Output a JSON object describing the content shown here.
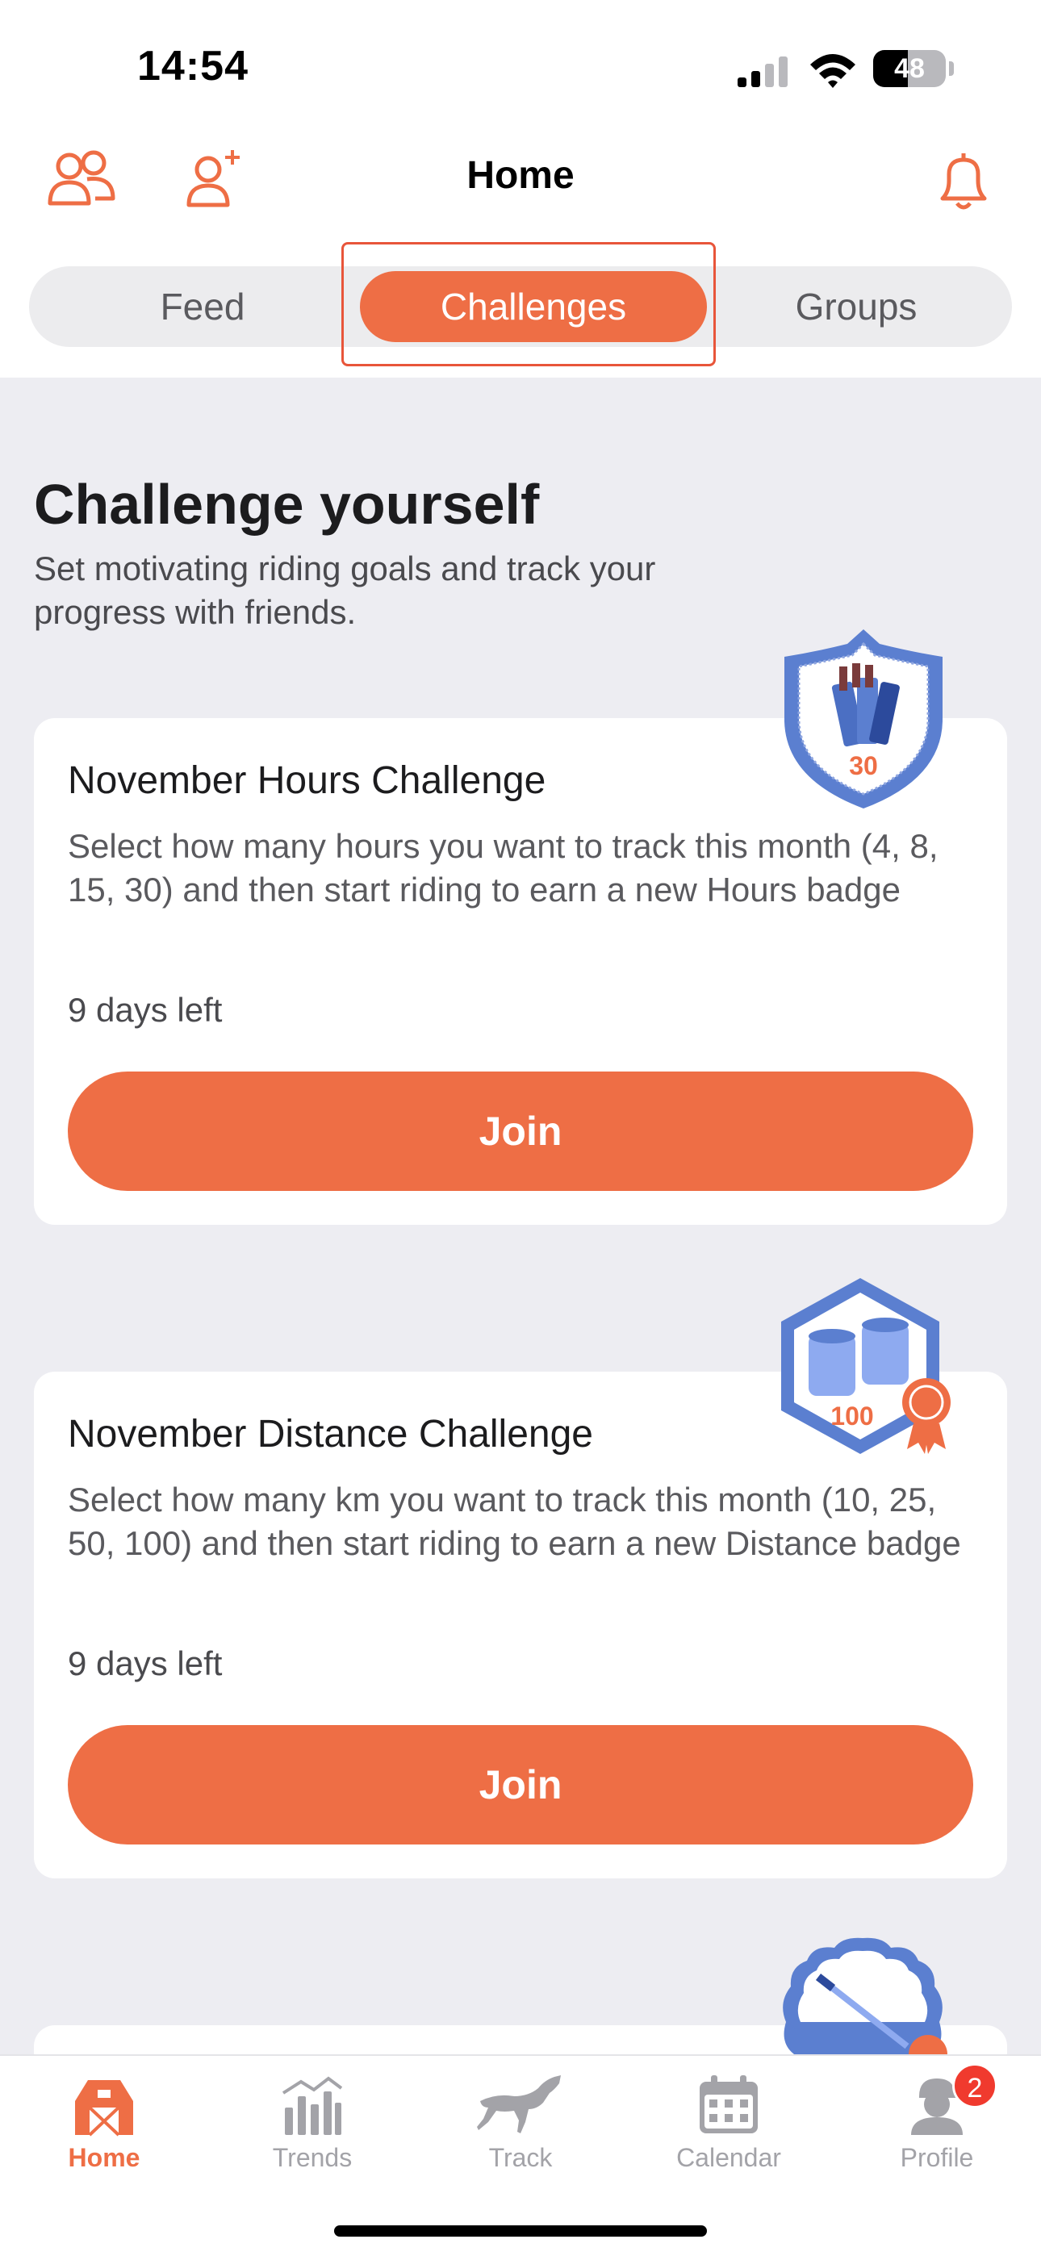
{
  "status": {
    "time": "14:54",
    "battery": "48",
    "battery_level": 0.48
  },
  "header": {
    "title": "Home"
  },
  "segments": {
    "feed": "Feed",
    "challenges": "Challenges",
    "groups": "Groups",
    "selected": "Challenges"
  },
  "intro": {
    "title": "Challenge yourself",
    "subtitle": "Set motivating riding goals and track your progress with friends."
  },
  "challenges": [
    {
      "title": "November Hours Challenge",
      "description": "Select how many hours you want to track this month (4, 8, 15, 30) and then start riding to earn a new Hours badge",
      "days_left": "9 days left",
      "button": "Join",
      "badge_number": "30",
      "badge_icon": "shield-hours-badge-icon"
    },
    {
      "title": "November Distance Challenge",
      "description": "Select how many km you want to track this month (10, 25, 50, 100) and then start riding to earn a new Distance badge",
      "days_left": "9 days left",
      "button": "Join",
      "badge_number": "100",
      "badge_icon": "hexagon-distance-badge-icon"
    }
  ],
  "tabbar": {
    "home": "Home",
    "trends": "Trends",
    "track": "Track",
    "calendar": "Calendar",
    "profile": "Profile",
    "profile_badge": "2"
  },
  "colors": {
    "accent": "#ee6e45",
    "badge_blue": "#5b7fd0",
    "background": "#ededf2",
    "notification": "#f03a2e"
  }
}
